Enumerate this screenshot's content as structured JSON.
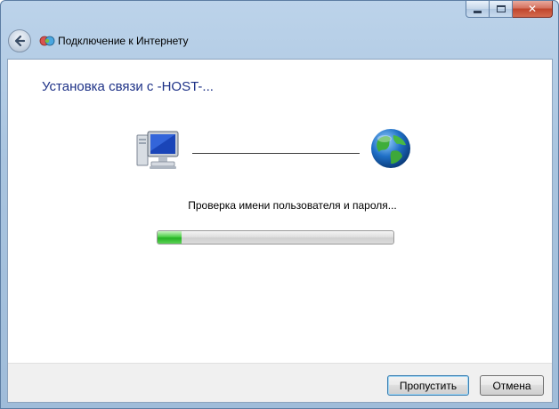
{
  "window": {
    "caption_buttons": {
      "minimize_icon": "minimize-icon",
      "maximize_icon": "maximize-icon",
      "close_glyph": "✕"
    }
  },
  "navbar": {
    "back_icon": "back-arrow-icon",
    "app_icon": "network-connection-icon",
    "title": "Подключение к Интернету"
  },
  "main": {
    "heading": "Установка связи с -HOST-...",
    "computer_icon": "computer-icon",
    "globe_icon": "globe-icon",
    "status": "Проверка имени пользователя и пароля...",
    "progress_fraction": 0.1
  },
  "footer": {
    "skip_label": "Пропустить",
    "cancel_label": "Отмена"
  },
  "colors": {
    "heading": "#1e3287",
    "progress_green": "#25b223",
    "frame": "#a9c4df"
  }
}
